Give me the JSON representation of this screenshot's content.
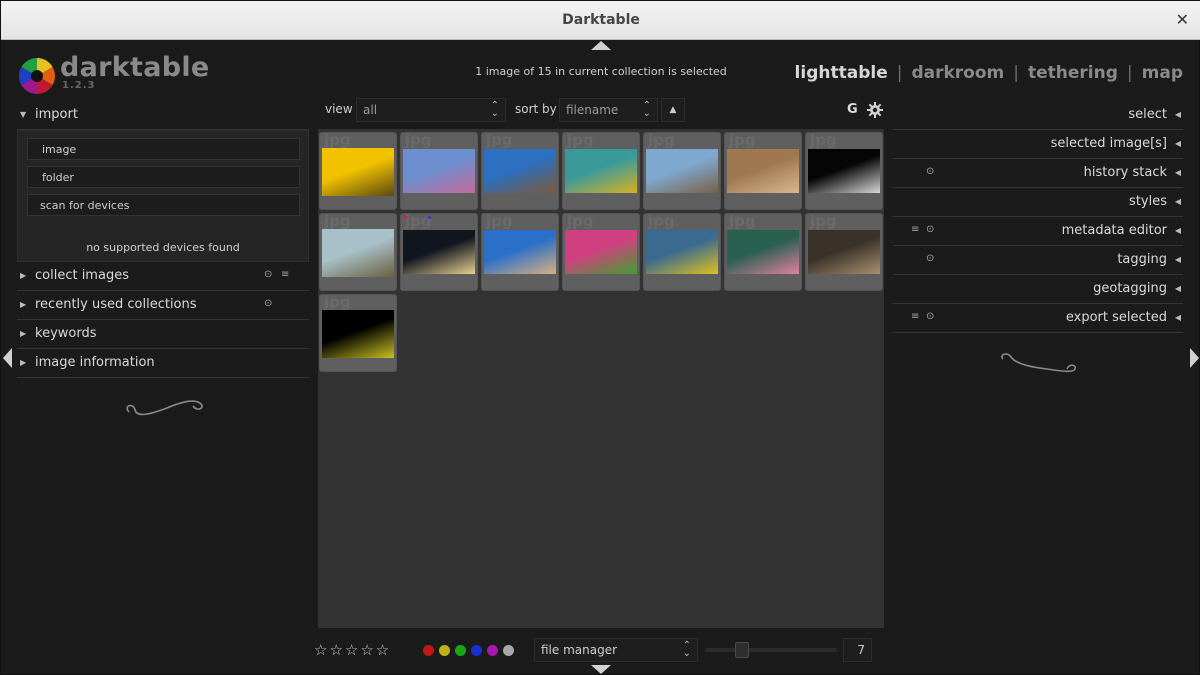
{
  "window": {
    "title": "Darktable"
  },
  "logo": {
    "name": "darktable",
    "version": "1.2.3"
  },
  "status": {
    "selection": "1 image of 15 in current collection is selected"
  },
  "views": [
    {
      "label": "lighttable",
      "active": true
    },
    {
      "label": "darkroom",
      "active": false
    },
    {
      "label": "tethering",
      "active": false
    },
    {
      "label": "map",
      "active": false
    }
  ],
  "view_separator": "|",
  "left_panel": {
    "import": {
      "title": "import",
      "buttons": [
        "image",
        "folder",
        "scan for devices"
      ],
      "message": "no supported devices found"
    },
    "modules": [
      {
        "label": "collect images",
        "icons": [
          "reset-icon",
          "presets-icon"
        ]
      },
      {
        "label": "recently used collections",
        "icons": [
          "reset-icon"
        ]
      },
      {
        "label": "keywords",
        "icons": []
      },
      {
        "label": "image information",
        "icons": []
      }
    ]
  },
  "toolbar": {
    "view_label": "view",
    "view_value": "all",
    "sort_label": "sort by",
    "sort_value": "filename",
    "sort_direction": "▲",
    "grouping_label": "G"
  },
  "thumbnails": [
    {
      "ext": "jpg",
      "colors": [
        "#f2c200",
        "#5a4a10"
      ]
    },
    {
      "ext": "jpg",
      "colors": [
        "#6d8fd0",
        "#c46a9a"
      ]
    },
    {
      "ext": "jpg",
      "colors": [
        "#2d6fc0",
        "#7a5a3c"
      ]
    },
    {
      "ext": "jpg",
      "colors": [
        "#3a9a9a",
        "#d8b020"
      ]
    },
    {
      "ext": "jpg",
      "colors": [
        "#7ea8d0",
        "#7a6048"
      ]
    },
    {
      "ext": "jpg",
      "colors": [
        "#a07850",
        "#d8b890"
      ]
    },
    {
      "ext": "jpg",
      "colors": [
        "#050505",
        "#d8d8d8"
      ]
    },
    {
      "ext": "jpg",
      "colors": [
        "#a8c0c8",
        "#6a6040"
      ]
    },
    {
      "ext": "jpg",
      "colors": [
        "#101520",
        "#e8d090"
      ],
      "labels": [
        "#e02020",
        "#2040e0"
      ]
    },
    {
      "ext": "jpg",
      "colors": [
        "#2a70c8",
        "#d8b080"
      ]
    },
    {
      "ext": "jpg",
      "colors": [
        "#d04080",
        "#40a030"
      ]
    },
    {
      "ext": "jpg",
      "colors": [
        "#3a6a90",
        "#e0c020"
      ]
    },
    {
      "ext": "jpg",
      "colors": [
        "#2a6050",
        "#e080a0"
      ]
    },
    {
      "ext": "jpg",
      "colors": [
        "#3a3228",
        "#a89070"
      ]
    },
    {
      "ext": "jpg",
      "colors": [
        "#000000",
        "#c8c020"
      ]
    }
  ],
  "bottom": {
    "stars": "☆☆☆☆☆",
    "color_labels": [
      "#c01818",
      "#c0b018",
      "#18a818",
      "#1830d0",
      "#a818b0",
      "#a8a8a8"
    ],
    "layout_value": "file manager",
    "zoom_value": "7",
    "zoom_level": 7,
    "zoom_range": [
      1,
      25
    ]
  },
  "right_panel": {
    "modules": [
      {
        "label": "select",
        "icons": []
      },
      {
        "label": "selected image[s]",
        "icons": []
      },
      {
        "label": "history stack",
        "icons": [
          "reset-icon"
        ]
      },
      {
        "label": "styles",
        "icons": []
      },
      {
        "label": "metadata editor",
        "icons": [
          "presets-icon",
          "reset-icon"
        ]
      },
      {
        "label": "tagging",
        "icons": [
          "reset-icon"
        ]
      },
      {
        "label": "geotagging",
        "icons": []
      },
      {
        "label": "export selected",
        "icons": [
          "presets-icon",
          "reset-icon"
        ]
      }
    ]
  }
}
